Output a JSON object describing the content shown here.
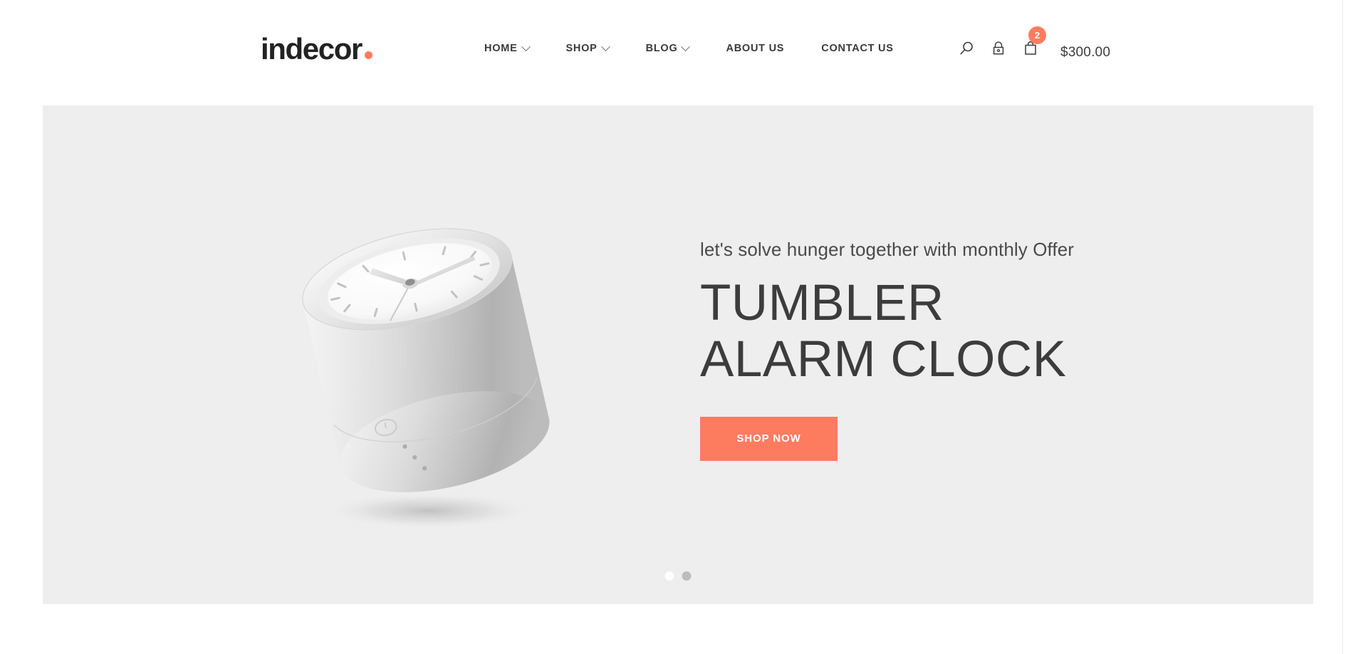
{
  "brand": {
    "name": "indecor",
    "dot_color": "#fd7c60"
  },
  "nav": {
    "items": [
      {
        "label": "HOME",
        "has_caret": true
      },
      {
        "label": "SHOP",
        "has_caret": true
      },
      {
        "label": "BLOG",
        "has_caret": true
      },
      {
        "label": "ABOUT US",
        "has_caret": false
      },
      {
        "label": "CONTACT US",
        "has_caret": false
      }
    ]
  },
  "tools": {
    "search_icon": "search-icon",
    "account_icon": "lock-icon",
    "cart_icon": "shopping-bag-icon",
    "cart_count": "2",
    "cart_total": "$300.00"
  },
  "hero": {
    "eyebrow": "let's solve hunger together with monthly Offer",
    "title": "TUMBLER ALARM CLOCK",
    "cta_label": "SHOP NOW",
    "background_color": "#eeeeee",
    "accent_color": "#fd7c60",
    "product_image_alt": "tumbler-alarm-clock",
    "slides": [
      {
        "active": true
      },
      {
        "active": false
      }
    ]
  }
}
